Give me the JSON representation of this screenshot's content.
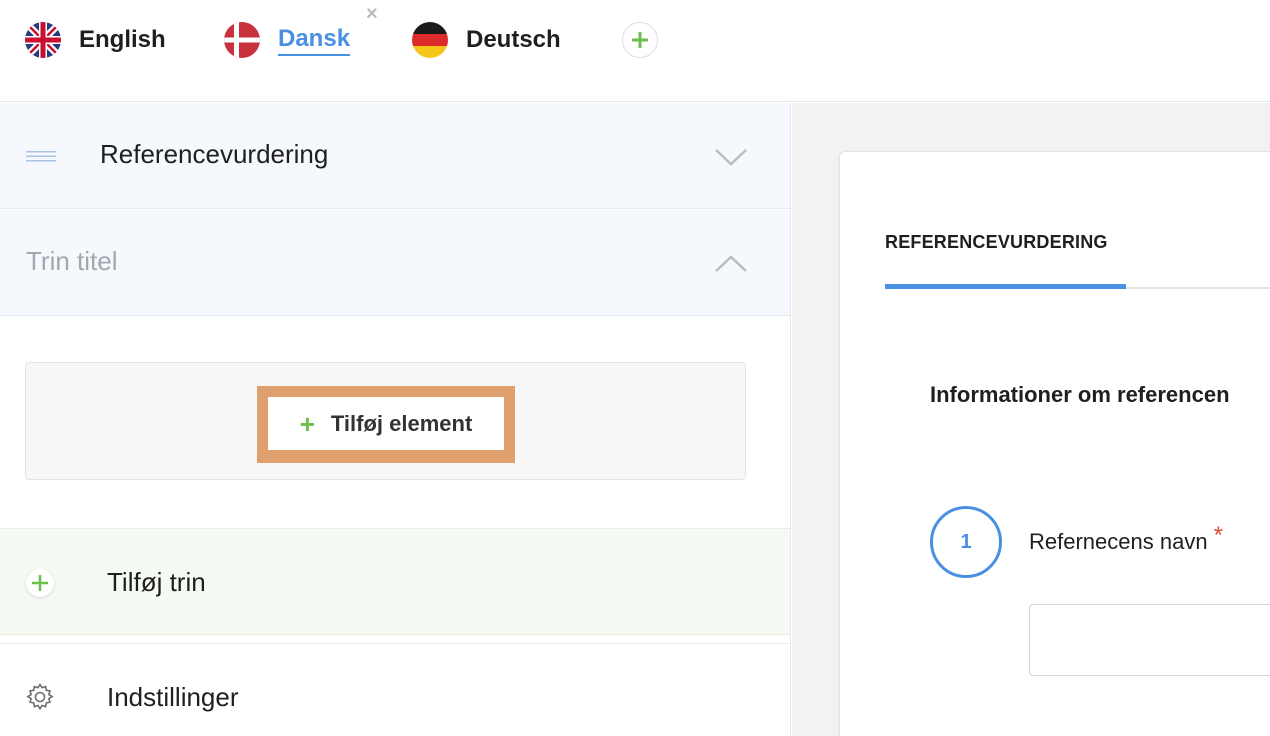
{
  "languages": [
    {
      "label": "English",
      "icon": "uk-flag-icon"
    },
    {
      "label": "Dansk",
      "icon": "danish-flag-icon",
      "active": true
    },
    {
      "label": "Deutsch",
      "icon": "german-flag-icon"
    }
  ],
  "lang_close_glyph": "×",
  "left_panel": {
    "section_title": "Referencevurdering",
    "step_title_placeholder": "Trin titel",
    "add_element_label": "Tilføj element",
    "add_element_plus": "+",
    "add_step_label": "Tilføj trin",
    "settings_label": "Indstillinger"
  },
  "preview": {
    "tab_label": "REFERENCEVURDERING",
    "section_heading": "Informationer om referencen",
    "question_number": "1",
    "question_label": "Refernecens navn",
    "required_mark": "*"
  },
  "colors": {
    "accent": "#4a90e2",
    "green": "#6cc04a",
    "highlight": "#dea06e",
    "required": "#e04e39"
  }
}
